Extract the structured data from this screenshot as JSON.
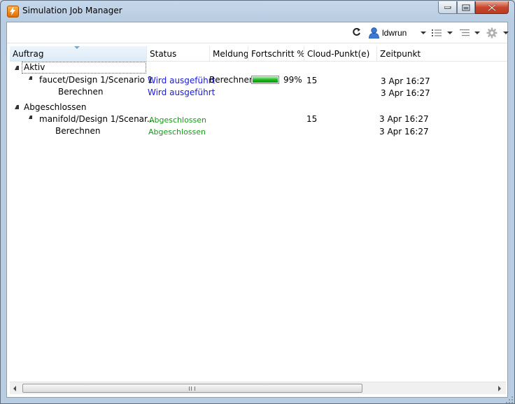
{
  "window": {
    "title": "Simulation Job Manager",
    "close_color": "#c8462e"
  },
  "toolbar": {
    "refresh_icon": "refresh-icon",
    "user_name": "ldwrun",
    "list_view_icon": "list-view-icon",
    "tree_view_icon": "tree-view-icon",
    "settings_icon": "gear-icon"
  },
  "columns": {
    "auftrag": "Auftrag",
    "status": "Status",
    "meldung": "Meldung",
    "fortschritt": "Fortschritt %",
    "cloud": "Cloud-Punkt(e)",
    "zeitpunkt": "Zeitpunkt"
  },
  "groups": [
    {
      "label": "Aktiv",
      "job": {
        "name": "faucet/Design 1/Scenario 1",
        "status": "Wird ausgeführt",
        "meldung": "Berechnen",
        "progress": 0.99,
        "progress_label": "99%",
        "cloud": "15",
        "zeitpunkt": "3 Apr 16:27"
      },
      "task": {
        "name": "Berechnen",
        "status": "Wird ausgeführt",
        "zeitpunkt": "3 Apr 16:27"
      }
    },
    {
      "label": "Abgeschlossen",
      "job": {
        "name": "manifold/Design 1/Scenar...",
        "status": "Abgeschlossen",
        "cloud": "15",
        "zeitpunkt": "3 Apr 16:27"
      },
      "task": {
        "name": "Berechnen",
        "status": "Abgeschlossen",
        "zeitpunkt": "3 Apr 16:27"
      }
    }
  ],
  "colors": {
    "running": "#1a1adf",
    "completed": "#1a9a1a",
    "progress": "#1fb51f"
  }
}
